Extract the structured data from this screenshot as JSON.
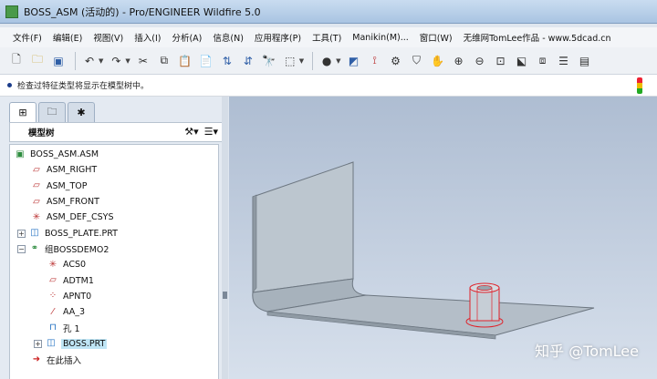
{
  "window": {
    "title": "BOSS_ASM (活动的) - Pro/ENGINEER Wildfire 5.0"
  },
  "menu": [
    "文件(F)",
    "编辑(E)",
    "视图(V)",
    "插入(I)",
    "分析(A)",
    "信息(N)",
    "应用程序(P)",
    "工具(T)",
    "Manikin(M)...",
    "窗口(W)",
    "无维网TomLee作品 - www.5dcad.cn"
  ],
  "status": {
    "message": "检查过特征类型将显示在模型树中。"
  },
  "panel": {
    "header": "模型树",
    "tree": [
      {
        "label": "BOSS_ASM.ASM"
      },
      {
        "label": "ASM_RIGHT"
      },
      {
        "label": "ASM_TOP"
      },
      {
        "label": "ASM_FRONT"
      },
      {
        "label": "ASM_DEF_CSYS"
      },
      {
        "label": "BOSS_PLATE.PRT"
      },
      {
        "label": "组BOSSDEMO2"
      },
      {
        "label": "ACS0"
      },
      {
        "label": "ADTM1"
      },
      {
        "label": "APNT0"
      },
      {
        "label": "AA_3"
      },
      {
        "label": "孔 1"
      },
      {
        "label": "BOSS.PRT"
      },
      {
        "label": "在此插入"
      }
    ]
  },
  "viewport": {
    "watermark": "知乎 @TomLee"
  }
}
